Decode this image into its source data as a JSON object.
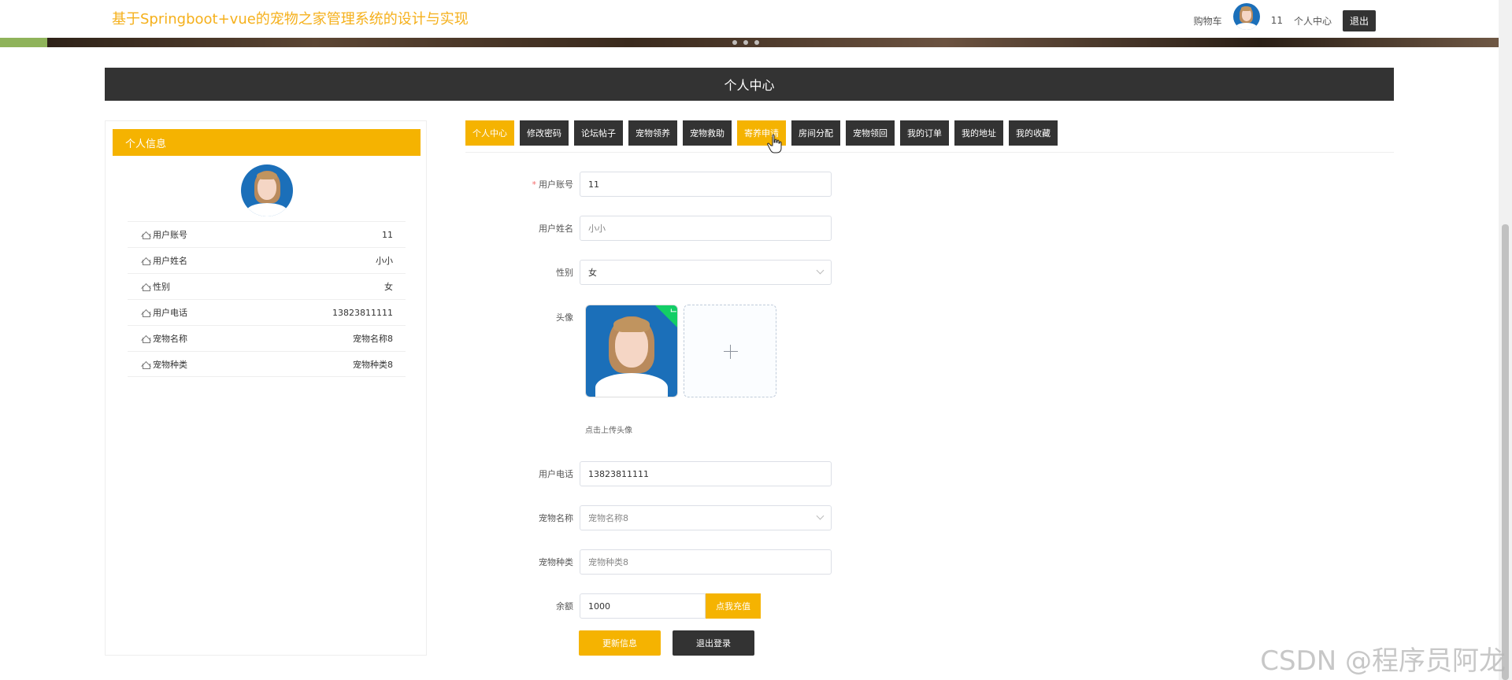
{
  "header": {
    "site_title": "基于Springboot+vue的宠物之家管理系统的设计与实现",
    "cart_label": "购物车",
    "username": "11",
    "center_label": "个人中心",
    "logout_label": "退出"
  },
  "page_title": "个人中心",
  "left_panel": {
    "heading": "个人信息",
    "rows": [
      {
        "label": "用户账号",
        "value": "11"
      },
      {
        "label": "用户姓名",
        "value": "小小"
      },
      {
        "label": "性别",
        "value": "女"
      },
      {
        "label": "用户电话",
        "value": "13823811111"
      },
      {
        "label": "宠物名称",
        "value": "宠物名称8"
      },
      {
        "label": "宠物种类",
        "value": "宠物种类8"
      }
    ]
  },
  "tabs": [
    "个人中心",
    "修改密码",
    "论坛帖子",
    "宠物领养",
    "宠物救助",
    "寄养申请",
    "房间分配",
    "宠物领回",
    "我的订单",
    "我的地址",
    "我的收藏"
  ],
  "form": {
    "account_label": "用户账号",
    "account_value": "11",
    "name_label": "用户姓名",
    "name_value": "小小",
    "gender_label": "性别",
    "gender_value": "女",
    "avatar_label": "头像",
    "avatar_tip": "点击上传头像",
    "phone_label": "用户电话",
    "phone_value": "13823811111",
    "pet_name_label": "宠物名称",
    "pet_name_value": "宠物名称8",
    "pet_type_label": "宠物种类",
    "pet_type_value": "宠物种类8",
    "balance_label": "余额",
    "balance_value": "1000",
    "recharge_label": "点我充值",
    "update_label": "更新信息",
    "exit_label": "退出登录"
  },
  "watermark": "CSDN @程序员阿龙",
  "colors": {
    "accent": "#f5b301",
    "dark": "#333333",
    "title": "#f5b01b"
  }
}
